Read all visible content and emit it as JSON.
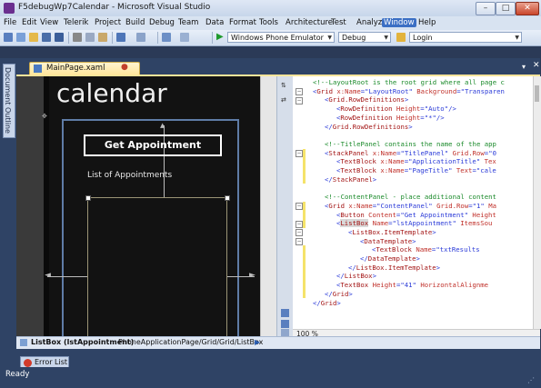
{
  "window": {
    "title": "F5debugWp7Calendar - Microsoft Visual Studio",
    "controls": {
      "minimize": "–",
      "maximize": "□",
      "close": "✕"
    }
  },
  "menu": [
    "File",
    "Edit",
    "View",
    "Telerik",
    "Project",
    "Build",
    "Debug",
    "Team",
    "Data",
    "Format",
    "Tools",
    "Architecture",
    "Test",
    "Analyze",
    "Window",
    "Help"
  ],
  "menu_active": "Window",
  "toolbar": {
    "device_combo": "Windows Phone Emulator",
    "config_combo": "Debug",
    "search_combo": "Login"
  },
  "side_tab": "Document Outline",
  "doc_tab": {
    "label": "MainPage.xaml",
    "modified": "●",
    "close": "✕",
    "dropdown": "▾"
  },
  "designer": {
    "page_title": "calendar",
    "button_label": "Get Appointment",
    "list_label": "List of Appointments"
  },
  "xaml_lines": [
    {
      "indent": 0,
      "parts": [
        {
          "c": "comment",
          "t": "<!--LayoutRoot is the root grid where all page c"
        }
      ]
    },
    {
      "indent": 0,
      "parts": [
        {
          "c": "punc",
          "t": "<"
        },
        {
          "c": "tag",
          "t": "Grid"
        },
        {
          "c": "attr",
          "t": " x:Name"
        },
        {
          "c": "punc",
          "t": "=\""
        },
        {
          "c": "val",
          "t": "LayoutRoot"
        },
        {
          "c": "punc",
          "t": "\""
        },
        {
          "c": "attr",
          "t": " Background"
        },
        {
          "c": "punc",
          "t": "=\""
        },
        {
          "c": "val",
          "t": "Transparen"
        }
      ]
    },
    {
      "indent": 1,
      "parts": [
        {
          "c": "punc",
          "t": "<"
        },
        {
          "c": "tag",
          "t": "Grid.RowDefinitions"
        },
        {
          "c": "punc",
          "t": ">"
        }
      ]
    },
    {
      "indent": 2,
      "parts": [
        {
          "c": "punc",
          "t": "<"
        },
        {
          "c": "tag",
          "t": "RowDefinition"
        },
        {
          "c": "attr",
          "t": " Height"
        },
        {
          "c": "punc",
          "t": "=\""
        },
        {
          "c": "val",
          "t": "Auto"
        },
        {
          "c": "punc",
          "t": "\"/>"
        }
      ]
    },
    {
      "indent": 2,
      "parts": [
        {
          "c": "punc",
          "t": "<"
        },
        {
          "c": "tag",
          "t": "RowDefinition"
        },
        {
          "c": "attr",
          "t": " Height"
        },
        {
          "c": "punc",
          "t": "=\""
        },
        {
          "c": "val",
          "t": "*"
        },
        {
          "c": "punc",
          "t": "\"/>"
        }
      ]
    },
    {
      "indent": 1,
      "parts": [
        {
          "c": "punc",
          "t": "</"
        },
        {
          "c": "tag",
          "t": "Grid.RowDefinitions"
        },
        {
          "c": "punc",
          "t": ">"
        }
      ]
    },
    {
      "indent": 0,
      "parts": []
    },
    {
      "indent": 1,
      "parts": [
        {
          "c": "comment",
          "t": "<!--TitlePanel contains the name of the app"
        }
      ]
    },
    {
      "indent": 1,
      "parts": [
        {
          "c": "punc",
          "t": "<"
        },
        {
          "c": "tag",
          "t": "StackPanel"
        },
        {
          "c": "attr",
          "t": " x:Name"
        },
        {
          "c": "punc",
          "t": "=\""
        },
        {
          "c": "val",
          "t": "TitlePanel"
        },
        {
          "c": "punc",
          "t": "\""
        },
        {
          "c": "attr",
          "t": " Grid.Row"
        },
        {
          "c": "punc",
          "t": "=\""
        },
        {
          "c": "val",
          "t": "0"
        }
      ]
    },
    {
      "indent": 2,
      "parts": [
        {
          "c": "punc",
          "t": "<"
        },
        {
          "c": "tag",
          "t": "TextBlock"
        },
        {
          "c": "attr",
          "t": " x:Name"
        },
        {
          "c": "punc",
          "t": "=\""
        },
        {
          "c": "val",
          "t": "ApplicationTitle"
        },
        {
          "c": "punc",
          "t": "\""
        },
        {
          "c": "attr",
          "t": " Tex"
        }
      ]
    },
    {
      "indent": 2,
      "parts": [
        {
          "c": "punc",
          "t": "<"
        },
        {
          "c": "tag",
          "t": "TextBlock"
        },
        {
          "c": "attr",
          "t": " x:Name"
        },
        {
          "c": "punc",
          "t": "=\""
        },
        {
          "c": "val",
          "t": "PageTitle"
        },
        {
          "c": "punc",
          "t": "\""
        },
        {
          "c": "attr",
          "t": " Text"
        },
        {
          "c": "punc",
          "t": "=\""
        },
        {
          "c": "val",
          "t": "cale"
        }
      ]
    },
    {
      "indent": 1,
      "parts": [
        {
          "c": "punc",
          "t": "</"
        },
        {
          "c": "tag",
          "t": "StackPanel"
        },
        {
          "c": "punc",
          "t": ">"
        }
      ]
    },
    {
      "indent": 0,
      "parts": []
    },
    {
      "indent": 1,
      "parts": [
        {
          "c": "comment",
          "t": "<!--ContentPanel - place additional content"
        }
      ]
    },
    {
      "indent": 1,
      "parts": [
        {
          "c": "punc",
          "t": "<"
        },
        {
          "c": "tag",
          "t": "Grid"
        },
        {
          "c": "attr",
          "t": " x:Name"
        },
        {
          "c": "punc",
          "t": "=\""
        },
        {
          "c": "val",
          "t": "ContentPanel"
        },
        {
          "c": "punc",
          "t": "\""
        },
        {
          "c": "attr",
          "t": " Grid.Row"
        },
        {
          "c": "punc",
          "t": "=\""
        },
        {
          "c": "val",
          "t": "1"
        },
        {
          "c": "punc",
          "t": "\""
        },
        {
          "c": "attr",
          "t": " Ma"
        }
      ]
    },
    {
      "indent": 2,
      "parts": [
        {
          "c": "punc",
          "t": "<"
        },
        {
          "c": "tag",
          "t": "Button"
        },
        {
          "c": "attr",
          "t": " Content"
        },
        {
          "c": "punc",
          "t": "=\""
        },
        {
          "c": "val",
          "t": "Get Appointment"
        },
        {
          "c": "punc",
          "t": "\""
        },
        {
          "c": "attr",
          "t": " Height"
        }
      ]
    },
    {
      "indent": 2,
      "parts": [
        {
          "c": "punc",
          "t": "<"
        },
        {
          "c": "tag hl",
          "t": "ListBox"
        },
        {
          "c": "attr",
          "t": " Name"
        },
        {
          "c": "punc",
          "t": "=\""
        },
        {
          "c": "val",
          "t": "lstAppointment"
        },
        {
          "c": "punc",
          "t": "\""
        },
        {
          "c": "attr",
          "t": " ItemsSou"
        }
      ]
    },
    {
      "indent": 3,
      "parts": [
        {
          "c": "punc",
          "t": "<"
        },
        {
          "c": "tag",
          "t": "ListBox.ItemTemplate"
        },
        {
          "c": "punc",
          "t": ">"
        }
      ]
    },
    {
      "indent": 4,
      "parts": [
        {
          "c": "punc",
          "t": "<"
        },
        {
          "c": "tag",
          "t": "DataTemplate"
        },
        {
          "c": "punc",
          "t": ">"
        }
      ]
    },
    {
      "indent": 5,
      "parts": [
        {
          "c": "punc",
          "t": "<"
        },
        {
          "c": "tag",
          "t": "TextBlock"
        },
        {
          "c": "attr",
          "t": " Name"
        },
        {
          "c": "punc",
          "t": "=\""
        },
        {
          "c": "val",
          "t": "txtResults"
        }
      ]
    },
    {
      "indent": 4,
      "parts": [
        {
          "c": "punc",
          "t": "</"
        },
        {
          "c": "tag",
          "t": "DataTemplate"
        },
        {
          "c": "punc",
          "t": ">"
        }
      ]
    },
    {
      "indent": 3,
      "parts": [
        {
          "c": "punc",
          "t": "</"
        },
        {
          "c": "tag",
          "t": "ListBox.ItemTemplate"
        },
        {
          "c": "punc",
          "t": ">"
        }
      ]
    },
    {
      "indent": 2,
      "parts": [
        {
          "c": "punc",
          "t": "</"
        },
        {
          "c": "tag",
          "t": "ListBox"
        },
        {
          "c": "punc",
          "t": ">"
        }
      ]
    },
    {
      "indent": 2,
      "parts": [
        {
          "c": "punc",
          "t": "<"
        },
        {
          "c": "tag",
          "t": "TextBox"
        },
        {
          "c": "attr",
          "t": " Height"
        },
        {
          "c": "punc",
          "t": "=\""
        },
        {
          "c": "val",
          "t": "41"
        },
        {
          "c": "punc",
          "t": "\""
        },
        {
          "c": "attr",
          "t": " HorizontalAlignme"
        }
      ]
    },
    {
      "indent": 1,
      "parts": [
        {
          "c": "punc",
          "t": "</"
        },
        {
          "c": "tag",
          "t": "Grid"
        },
        {
          "c": "punc",
          "t": ">"
        }
      ]
    },
    {
      "indent": 0,
      "parts": [
        {
          "c": "punc",
          "t": "</"
        },
        {
          "c": "tag",
          "t": "Grid"
        },
        {
          "c": "punc",
          "t": ">"
        }
      ]
    }
  ],
  "zoom": "100 %",
  "breadcrumb": {
    "selected": "ListBox (lstAppointment)",
    "path": "PhoneApplicationPage/Grid/Grid/ListBox",
    "arrow": "▶"
  },
  "error_tab": "Error List",
  "status": "Ready"
}
